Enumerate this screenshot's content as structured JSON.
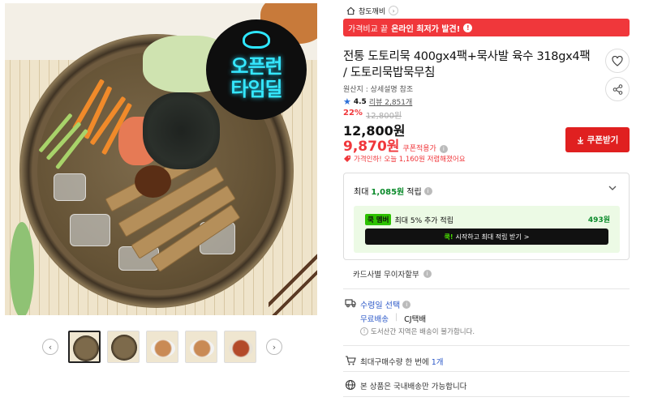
{
  "gallery": {
    "badge_line1": "오픈런",
    "badge_line2": "타임딜",
    "prev_icon": "chevron-left-icon",
    "next_icon": "chevron-right-icon",
    "thumbnail_count": 5,
    "active_thumbnail": 1
  },
  "breadcrumb": {
    "icon": "home-icon",
    "label": "참도깨비"
  },
  "promo": {
    "prefix": "가격비교 끝",
    "highlight": "온라인 최저가 발견!",
    "icon": "info-icon"
  },
  "product": {
    "title": "전통 도토리묵 400gx4팩+묵사발 육수 318gx4팩 / 도토리묵밥묵무침",
    "origin": "원산지 : 상세설명 참조",
    "rating": "4.5",
    "reviews": "리뷰 2,851개",
    "discount_pct": "22%",
    "original_price": "12,800원",
    "sale_price": "12,800원",
    "coupon_price": "9,870원",
    "coupon_price_label": "쿠폰적용가",
    "price_note": "가격인하! 오늘 1,160원 저렴해졌어요",
    "coupon_button": "쿠폰받기"
  },
  "actions": {
    "wishlist_icon": "heart-icon",
    "share_icon": "share-icon"
  },
  "reward": {
    "prefix": "최대",
    "amount": "1,085원",
    "suffix": "적립",
    "member_badge": "멤버",
    "member_badge_prefix": "쿡",
    "member_text": "최대 5% 추가 적립",
    "member_amount": "493원",
    "member_button_hl": "쿡!",
    "member_button": "시작하고 최대 적립 받기",
    "member_button_arrow": ">"
  },
  "card": {
    "label": "카드사별 무이자할부"
  },
  "delivery": {
    "title": "수령일 선택",
    "free": "무료배송",
    "separator": "|",
    "carrier": "CJ택배",
    "note": "도서산간 지역은 배송이 불가합니다."
  },
  "purchase": {
    "maxbuy_prefix": "최대구매수량 한 번에",
    "maxbuy_num": "1개",
    "domestic": "본 상품은 국내배송만 가능합니다"
  },
  "colors": {
    "accent_red": "#f0373b",
    "coupon_button": "#e02020",
    "link_blue": "#2b58c8",
    "reward_green": "#0a8a2a",
    "member_bg": "#ecfae5"
  }
}
